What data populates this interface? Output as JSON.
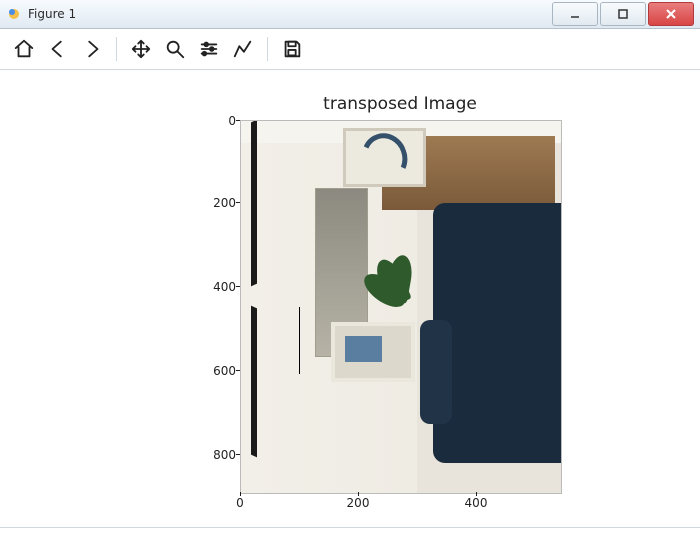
{
  "window": {
    "title": "Figure 1"
  },
  "toolbar": {
    "home": "Home",
    "back": "Back",
    "forward": "Forward",
    "pan": "Pan",
    "zoom": "Zoom",
    "subplots": "Configure subplots",
    "edit": "Edit axis",
    "save": "Save"
  },
  "plot": {
    "title": "transposed Image",
    "xticks": [
      "0",
      "200",
      "400"
    ],
    "yticks": [
      "0",
      "200",
      "400",
      "600",
      "800"
    ]
  }
}
